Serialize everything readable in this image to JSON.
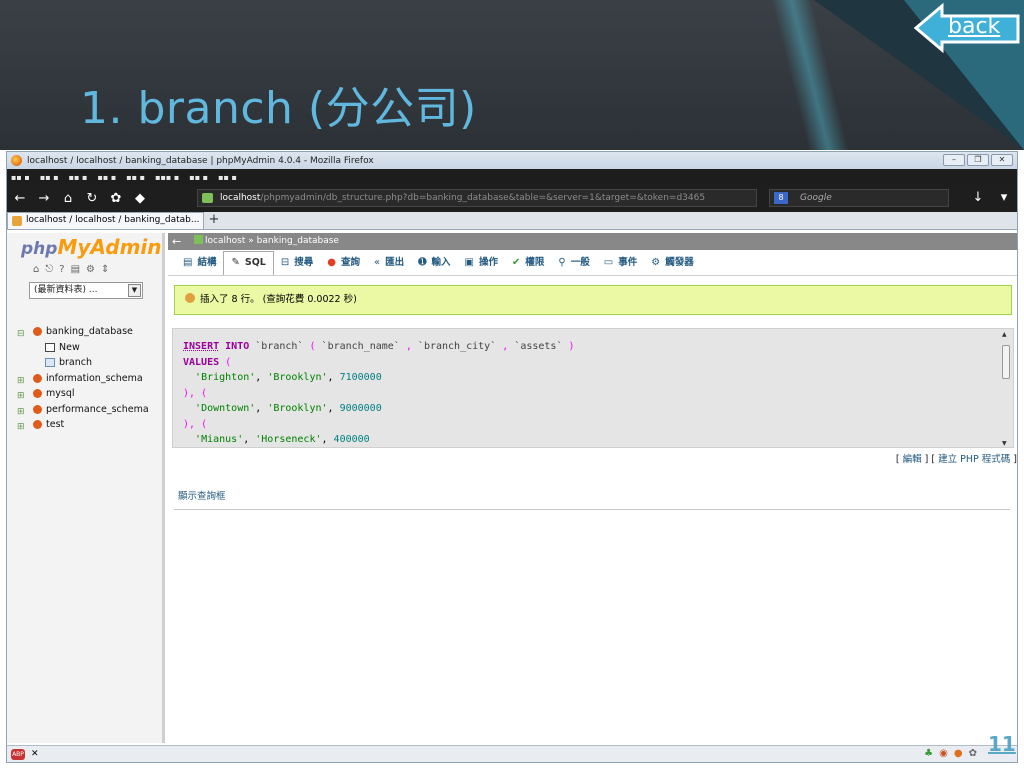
{
  "slide": {
    "title": "1. branch (分公司)",
    "back_label": "back",
    "page_number": "11"
  },
  "browser": {
    "window_title": "localhost / localhost / banking_database | phpMyAdmin 4.0.4 - Mozilla Firefox",
    "url_host": "localhost",
    "url_path": "/phpmyadmin/db_structure.php?db=banking_database&table=&server=1&target=&token=d3465",
    "search_placeholder": "Google",
    "tab_title": "localhost / localhost / banking_datab...",
    "tab_new": "+"
  },
  "pma": {
    "logo_php": "php",
    "logo_myadmin": "MyAdmin",
    "recent_select": "(最新資料表) ...",
    "tree": [
      {
        "label": "banking_database",
        "kind": "db"
      },
      {
        "label": "New",
        "kind": "new"
      },
      {
        "label": "branch",
        "kind": "table"
      },
      {
        "label": "information_schema",
        "kind": "db"
      },
      {
        "label": "mysql",
        "kind": "db"
      },
      {
        "label": "performance_schema",
        "kind": "db"
      },
      {
        "label": "test",
        "kind": "db"
      }
    ],
    "breadcrumb_server": "localhost",
    "breadcrumb_sep": "»",
    "breadcrumb_db": "banking_database",
    "tabs": [
      {
        "label": "結構",
        "icon": "▤"
      },
      {
        "label": "SQL",
        "icon": "✎"
      },
      {
        "label": "搜尋",
        "icon": "⊟"
      },
      {
        "label": "查詢",
        "icon": "●"
      },
      {
        "label": "匯出",
        "icon": "«"
      },
      {
        "label": "輸入",
        "icon": "➊"
      },
      {
        "label": "操作",
        "icon": "▣"
      },
      {
        "label": "權限",
        "icon": "✔"
      },
      {
        "label": "一般",
        "icon": "⚲"
      },
      {
        "label": "事件",
        "icon": "▭"
      },
      {
        "label": "觸發器",
        "icon": "⚙"
      }
    ],
    "success_message": "插入了 8 行。 (查詢花費 0.0022 秒)",
    "sql": {
      "kw_insert": "INSERT",
      "kw_into": "INTO",
      "table": "`branch`",
      "paren_open": "(",
      "col1": "`branch_name`",
      "comma": ",",
      "col2": "`branch_city`",
      "col3": "`assets`",
      "paren_close": ")",
      "kw_values": "VALUES",
      "rows": [
        {
          "name": "'Brighton'",
          "city": "'Brooklyn'",
          "assets": "7100000"
        },
        {
          "name": "'Downtown'",
          "city": "'Brooklyn'",
          "assets": "9000000"
        },
        {
          "name": "'Mianus'",
          "city": "'Horseneck'",
          "assets": "400000"
        }
      ],
      "row_sep": "), (",
      "trailing": "), ("
    },
    "edit_link": "編輯",
    "create_php_link": "建立 PHP 程式碼",
    "show_query_box": "顯示查詢框"
  }
}
